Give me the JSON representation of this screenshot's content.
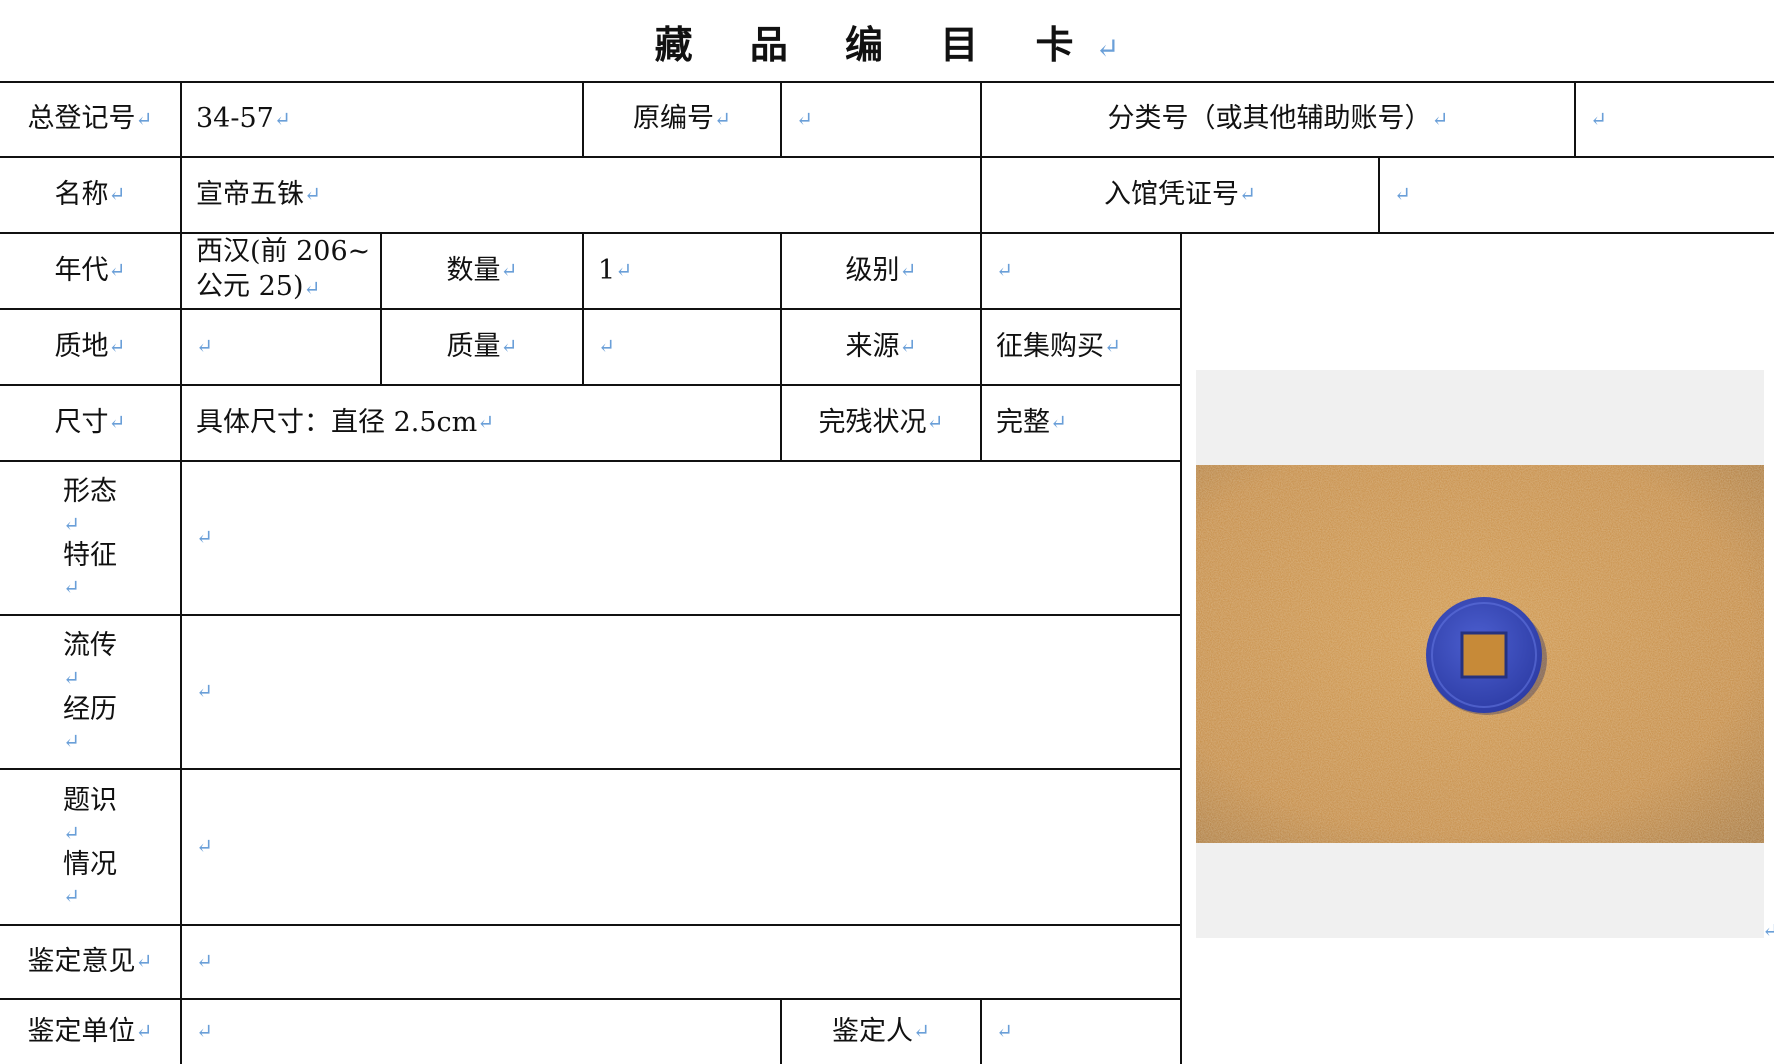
{
  "title": "藏 品 编 目 卡",
  "return_mark": "↵",
  "labels": {
    "zongdengji": "总登记号",
    "yuanbianhao": "原编号",
    "fenleihao": "分类号（或其他辅助账号）",
    "mingcheng": "名称",
    "ruguan": "入馆凭证号",
    "niandai": "年代",
    "shuliang": "数量",
    "jibie": "级别",
    "zhidi": "质地",
    "zhiliang": "质量",
    "laiyuan": "来源",
    "chicun": "尺寸",
    "wancan": "完残状况",
    "xingtai_1": "形态",
    "xingtai_2": "特征",
    "liuchuan_1": "流传",
    "liuchuan_2": "经历",
    "tishi_1": "题识",
    "tishi_2": "情况",
    "jianding_yijian": "鉴定意见",
    "jianding_danwei": "鉴定单位",
    "jianding_ren": "鉴定人"
  },
  "values": {
    "zongdengji": "34-57",
    "yuanbianhao": "",
    "fenleihao": "",
    "mingcheng": "宣帝五铢",
    "ruguan": "",
    "niandai_1": "西汉(前 206~",
    "niandai_2": "公元 25)",
    "shuliang": "1",
    "jibie": "",
    "zhidi": "",
    "zhiliang": "",
    "laiyuan": "征集购买",
    "chicun": "具体尺寸：直径 2.5cm",
    "wancan": "完整",
    "xingtai": "",
    "liuchuan": "",
    "tishi": "",
    "jianding_yijian": "",
    "jianding_danwei": "",
    "jianding_ren": ""
  },
  "photo": {
    "subject": "blue-coin-on-orange-cloth",
    "bg_color": "#c98a35",
    "coin_color": "#3d4fc0"
  }
}
